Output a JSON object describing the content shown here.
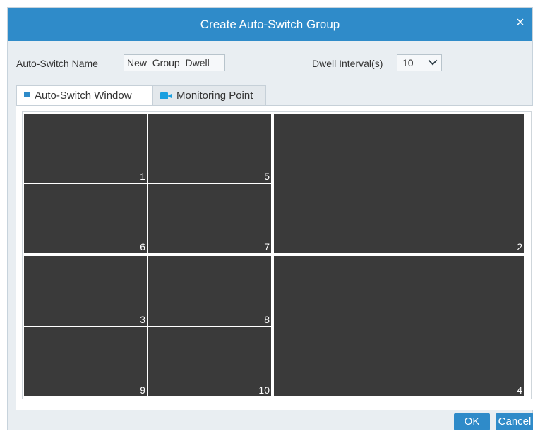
{
  "dialog": {
    "title": "Create Auto-Switch Group",
    "close_glyph": "×"
  },
  "form": {
    "name_label": "Auto-Switch Name",
    "name_value": "New_Group_Dwell",
    "dwell_label": "Dwell Interval(s)",
    "dwell_value": "10"
  },
  "tabs": [
    {
      "label": "Auto-Switch Window",
      "icon": "window-icon",
      "active": true
    },
    {
      "label": "Monitoring Point",
      "icon": "camera-icon",
      "active": false
    }
  ],
  "windows": [
    {
      "number": "1"
    },
    {
      "number": "5"
    },
    {
      "number": "6"
    },
    {
      "number": "7"
    },
    {
      "number": "2"
    },
    {
      "number": "3"
    },
    {
      "number": "8"
    },
    {
      "number": "9"
    },
    {
      "number": "10"
    },
    {
      "number": "4"
    }
  ],
  "buttons": {
    "ok": "OK",
    "cancel": "Cancel"
  },
  "colors": {
    "accent": "#2f8bc9",
    "window_bg": "#3a3a3a"
  }
}
